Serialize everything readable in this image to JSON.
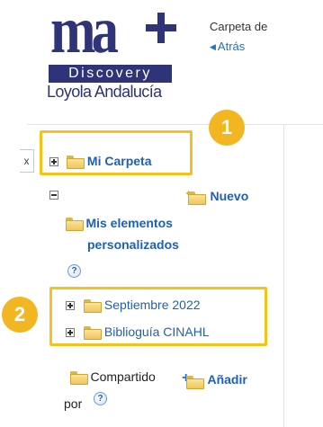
{
  "logo": {
    "mark": "ma",
    "band": "Discovery",
    "subtitle": "Loyola Andalucía"
  },
  "header": {
    "folder_of_label": "Carpeta de",
    "back_label": "Atrás"
  },
  "close_label": "x",
  "tree": {
    "root_folder": "Mi Carpeta",
    "new_label": "Nuevo",
    "custom_items": "Mis elementos personalizados",
    "custom_items_line1": "Mis elementos",
    "custom_items_line2": "personalizados",
    "subfolders": [
      {
        "label": "Septiembre 2022"
      },
      {
        "label": "Bibliоguía CINAHL"
      }
    ],
    "shared_label": "Compartido",
    "shared_by": "por",
    "add_label": "Añadir"
  },
  "help_glyph": "?",
  "annotations": {
    "badge_1": "1",
    "badge_2": "2",
    "highlight_color": "#f5c21b",
    "badge_color": "#f2b623"
  },
  "colors": {
    "brand": "#2e3477",
    "link": "#1f5fb8"
  }
}
